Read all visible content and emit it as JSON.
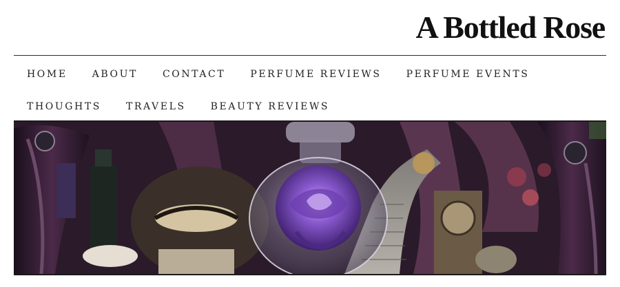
{
  "site": {
    "title": "A Bottled Rose"
  },
  "nav": {
    "row1": [
      "HOME",
      "ABOUT",
      "CONTACT",
      "PERFUME REVIEWS",
      "PERFUME EVENTS"
    ],
    "row2": [
      "THOUGHTS",
      "TRAVELS",
      "BEAUTY REVIEWS"
    ]
  },
  "banner": {
    "colors": {
      "velvet": "#4a2a45",
      "rose": "#7b4fc0",
      "rose_light": "#b794e8",
      "stone": "#8a8580"
    }
  }
}
